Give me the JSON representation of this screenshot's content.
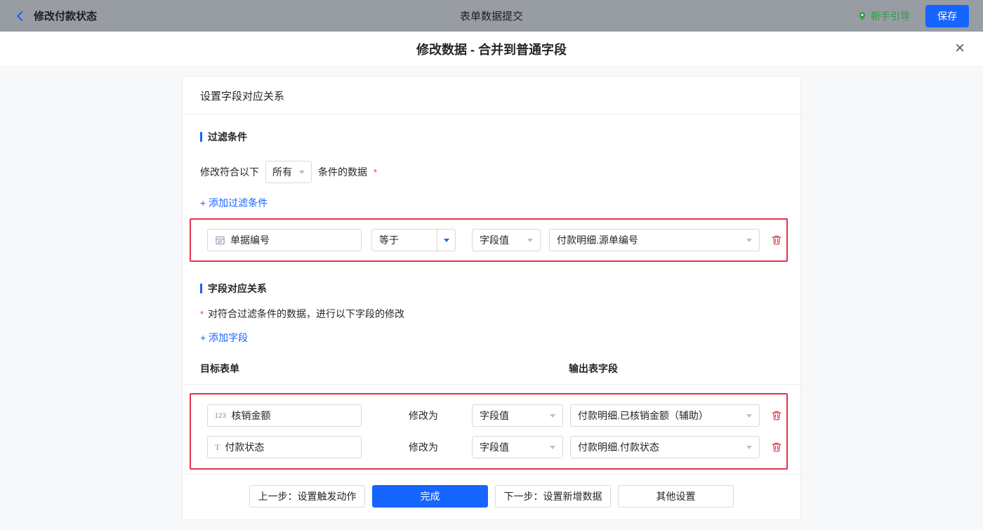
{
  "topbar": {
    "back_label": "修改付款状态",
    "center_title": "表单数据提交",
    "guide_label": "新手引导",
    "save_label": "保存"
  },
  "header": {
    "title": "修改数据 - 合并到普通字段",
    "close_glyph": "×"
  },
  "card": {
    "head_title": "设置字段对应关系",
    "filter": {
      "section_title": "过滤条件",
      "condition_prefix": "修改符合以下",
      "match_select_value": "所有",
      "condition_suffix": "条件的数据",
      "required_mark": "*",
      "add_link": "+ 添加过滤条件",
      "row": {
        "field": "单据编号",
        "operator": "等于",
        "value_type": "字段值",
        "value": "付款明细.源单编号"
      }
    },
    "mapping": {
      "section_title": "字段对应关系",
      "required_mark": "*",
      "description": "对符合过滤条件的数据，进行以下字段的修改",
      "add_link": "+ 添加字段",
      "columns": {
        "target": "目标表单",
        "output": "输出表字段"
      },
      "rows": [
        {
          "icon": "123",
          "field": "核销金额",
          "modify_label": "修改为",
          "value_type": "字段值",
          "value": "付款明细.已核销金额（辅助）"
        },
        {
          "icon": "T",
          "field": "付款状态",
          "modify_label": "修改为",
          "value_type": "字段值",
          "value": "付款明细.付款状态"
        }
      ]
    }
  },
  "footer": {
    "prev": "上一步：设置触发动作",
    "done": "完成",
    "next": "下一步：设置新增数据",
    "other": "其他设置"
  },
  "colors": {
    "accent_blue": "#1665ff",
    "success_green": "#2b9e45",
    "danger_red": "#e0334a",
    "topbar_gray": "#989ca3"
  }
}
